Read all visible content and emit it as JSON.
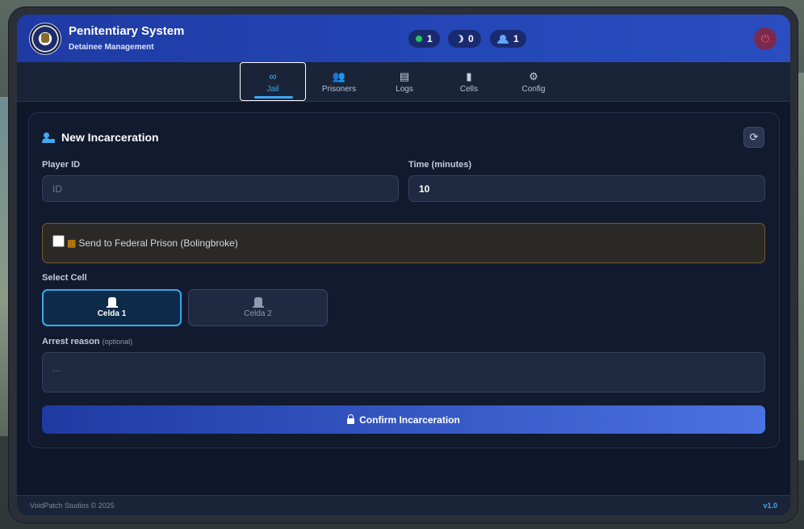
{
  "header": {
    "title": "Penitentiary System",
    "subtitle": "Detainee Management",
    "status": {
      "online": "1",
      "night": "0",
      "officers": "1"
    }
  },
  "tabs": [
    {
      "label": "Jail",
      "icon": "binoculars-icon"
    },
    {
      "label": "Prisoners",
      "icon": "users-icon"
    },
    {
      "label": "Logs",
      "icon": "clipboard-icon"
    },
    {
      "label": "Cells",
      "icon": "door-icon"
    },
    {
      "label": "Config",
      "icon": "gear-icon"
    }
  ],
  "form": {
    "title": "New Incarceration",
    "player_id_label": "Player ID",
    "player_id_placeholder": "ID",
    "time_label": "Time (minutes)",
    "time_value": "10",
    "federal_label": "Send to Federal Prison (Bolingbroke)",
    "select_cell_label": "Select Cell",
    "cells": [
      "Celda 1",
      "Celda 2"
    ],
    "reason_label": "Arrest reason",
    "reason_optional": "(optional)",
    "reason_placeholder": "...",
    "confirm_label": "Confirm Incarceration"
  },
  "footer": {
    "copyright": "VoidPatch Studios © 2025",
    "version": "v1.0"
  },
  "colors": {
    "accent": "#3fa9f5",
    "header": "#2447b8",
    "background": "#0f172a",
    "warning_border": "#7a5b2a",
    "power": "#ff4d6d"
  }
}
